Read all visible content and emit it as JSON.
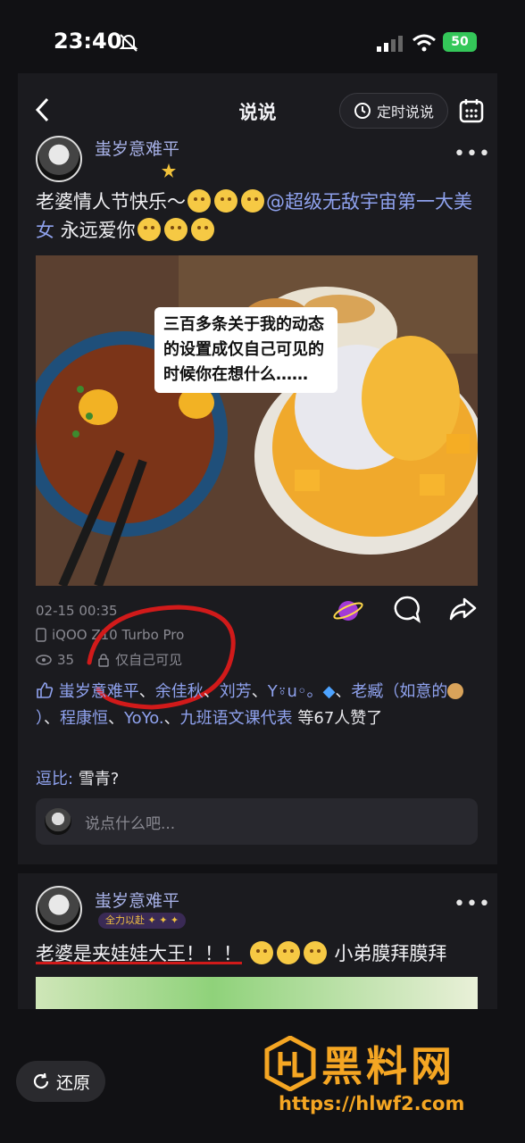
{
  "status": {
    "time": "23:40",
    "battery": "50"
  },
  "nav": {
    "title": "说说",
    "timed_post": "定时说说"
  },
  "post1": {
    "username": "蚩岁意难平",
    "content_start": "老婆情人节快乐～",
    "mention": "@超级无敌宇宙第一大美女",
    "content_end": "永远爱你",
    "overlay": "三百多条关于我的动态的设置成仅自己可见的时候你在想什么……",
    "date": "02-15 00:35",
    "device": "iQOO Z10 Turbo Pro",
    "views": "35",
    "privacy": "仅自己可见",
    "likes_names": [
      "蚩岁意难平",
      "余佳秋",
      "刘芳",
      "Y⍤u◦。",
      "老臧（如意的",
      "）",
      "程康恒",
      "YoYo.",
      "九班语文课代表"
    ],
    "likes_suffix": "等67人赞了",
    "comment_who": "逗比:",
    "comment_text": "雪青?",
    "input_placeholder": "说点什么吧..."
  },
  "post2": {
    "username": "蚩岁意难平",
    "badge": "全力以赴",
    "content": "老婆是夹娃娃大王！！！",
    "content_end": "小弟膜拜膜拜"
  },
  "restore_label": "还原",
  "watermark": {
    "brand": "黑料网",
    "url": "https://hlwf2.com"
  },
  "colors": {
    "accent": "#8fa2ee",
    "watermark": "#f5a623"
  }
}
